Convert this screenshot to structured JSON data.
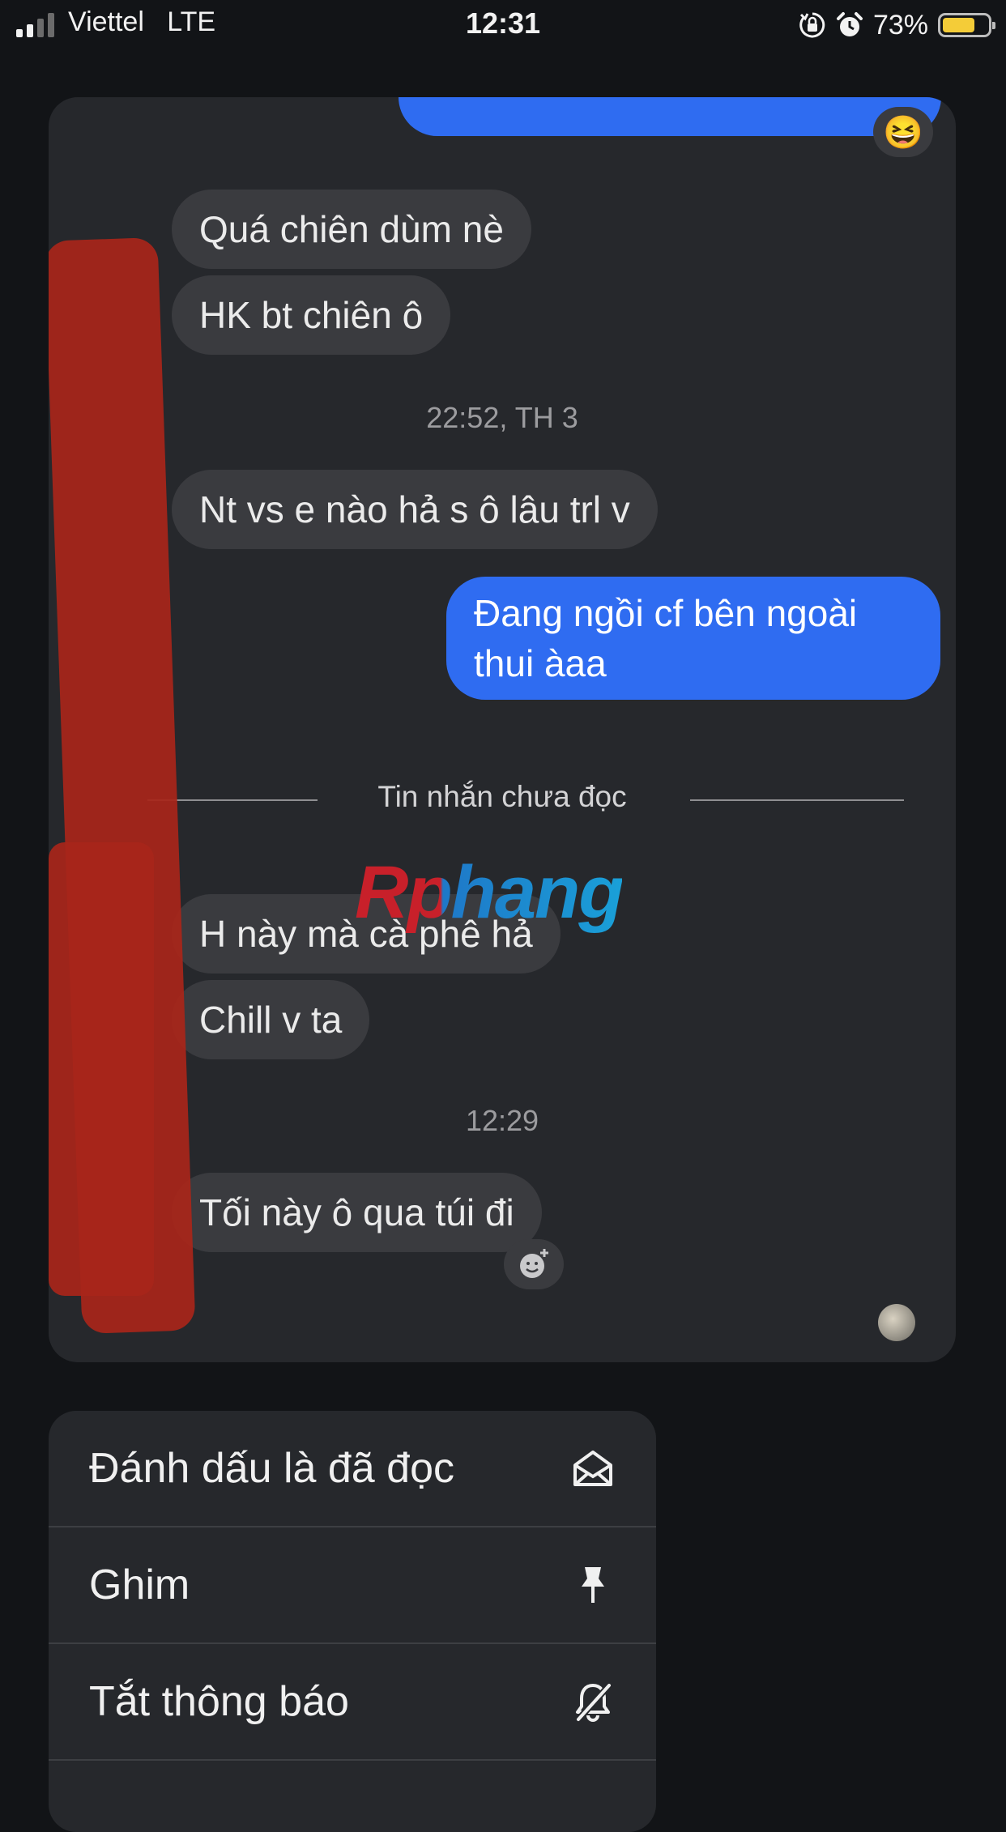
{
  "status_bar": {
    "carrier": "Viettel",
    "network": "LTE",
    "time": "12:31",
    "battery_percent": "73%",
    "battery_level": 0.73,
    "icons": [
      "signal-icon",
      "orientation-lock-icon",
      "alarm-icon",
      "battery-icon"
    ]
  },
  "chat": {
    "messages": [
      {
        "side": "incoming",
        "text": "Quá chiên dùm nè"
      },
      {
        "side": "incoming",
        "text": "HK bt chiên ô"
      },
      {
        "side": "incoming",
        "text": "Nt vs e nào hả s ô lâu trl v"
      },
      {
        "side": "outgoing",
        "text": "Đang ngồi cf bên ngoài thui àaa"
      },
      {
        "side": "incoming",
        "text": "H này mà cà phê hả"
      },
      {
        "side": "incoming",
        "text": "Chill v ta"
      },
      {
        "side": "incoming",
        "text": "Tối này ô qua túi đi"
      }
    ],
    "timestamps": [
      "22:52, TH 3",
      "12:29"
    ],
    "unread_divider": "Tin nhắn chưa đọc",
    "top_reaction": "😆",
    "watermark": "Rphang"
  },
  "menu": {
    "items": [
      {
        "label": "Đánh dấu là đã đọc",
        "icon": "mark-read-envelope-icon"
      },
      {
        "label": "Ghim",
        "icon": "pin-icon"
      },
      {
        "label": "Tắt thông báo",
        "icon": "bell-slash-icon"
      }
    ]
  },
  "colors": {
    "background": "#121417",
    "card": "#26282c",
    "incoming_bubble": "#3a3b3f",
    "outgoing_bubble": "#2f6cf1",
    "battery": "#f4cc38",
    "redaction": "#a8261a"
  }
}
